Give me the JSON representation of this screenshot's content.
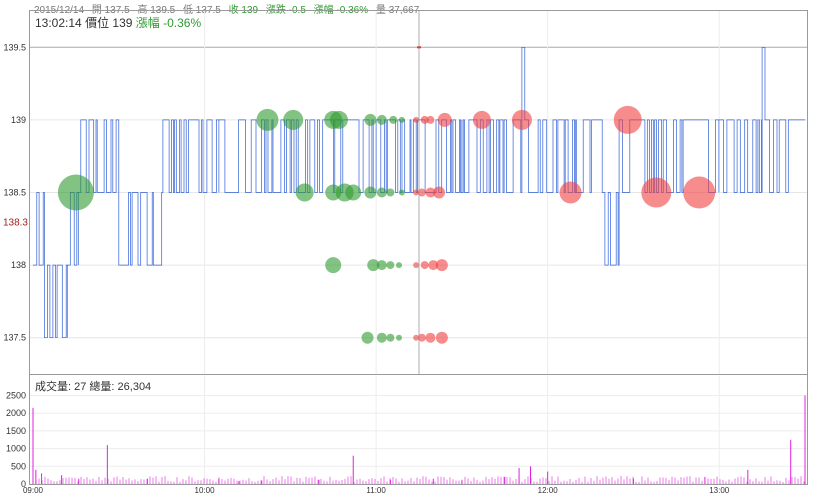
{
  "header": {
    "date": "2015/12/14",
    "open": "開 137.5",
    "high": "高 139.5",
    "low": "低 137.5",
    "close": "收 139",
    "change": "漲跌 -0.5",
    "change_pct": "漲幅 -0.36%",
    "volume": "量 37,667"
  },
  "crosshair": {
    "time": "13:02:14",
    "price_label": "價位 139",
    "change_pct": "漲幅 -0.36%"
  },
  "volume_panel": {
    "trade_volume": "成交量: 27",
    "total_volume": "總量: 26,304"
  },
  "colors": {
    "price_line": "#3060d8",
    "buy_bubble": "#2e9a2e",
    "sell_bubble": "#f04040",
    "volume_bar": "#e020e0",
    "reference_line": "#d04040"
  },
  "chart_data": [
    {
      "type": "line",
      "x_range": [
        "09:00",
        "13:30"
      ],
      "x_ticks": [
        "09:00",
        "10:00",
        "11:00",
        "12:00",
        "13:00"
      ],
      "ylim": [
        137.25,
        139.75
      ],
      "y_ticks": [
        "137.5",
        "138",
        "138.5",
        "139",
        "139.5"
      ],
      "reference_price": "138.3",
      "grid": true,
      "series": [
        {
          "points": [
            [
              "09:00",
              138.0
            ],
            [
              "09:04",
              137.5
            ],
            [
              "09:12",
              138.0
            ],
            [
              "09:16",
              138.5
            ],
            [
              "09:30",
              138.0
            ],
            [
              "09:45",
              138.5
            ],
            [
              "10:00",
              138.5
            ],
            [
              "10:05",
              139.0
            ],
            [
              "10:30",
              138.5
            ],
            [
              "11:00",
              139.0
            ],
            [
              "11:30",
              138.5
            ],
            [
              "11:40",
              139.0
            ],
            [
              "11:51",
              139.5
            ],
            [
              "11:52",
              139.0
            ],
            [
              "12:10",
              138.5
            ],
            [
              "12:20",
              138.0
            ],
            [
              "12:25",
              139.0
            ],
            [
              "12:40",
              138.5
            ],
            [
              "13:00",
              139.0
            ],
            [
              "13:10",
              138.5
            ],
            [
              "13:15",
              139.5
            ],
            [
              "13:16",
              139.0
            ],
            [
              "13:30",
              139.0
            ]
          ]
        }
      ],
      "bubbles": [
        {
          "t": "09:15",
          "price": 138.5,
          "size": 18,
          "side": "buy"
        },
        {
          "t": "10:22",
          "price": 139.0,
          "size": 11,
          "side": "buy"
        },
        {
          "t": "10:31",
          "price": 139.0,
          "size": 10,
          "side": "buy"
        },
        {
          "t": "10:35",
          "price": 138.5,
          "size": 9,
          "side": "buy"
        },
        {
          "t": "10:45",
          "price": 139.0,
          "size": 9,
          "side": "buy"
        },
        {
          "t": "10:47",
          "price": 139.0,
          "size": 9,
          "side": "buy"
        },
        {
          "t": "10:45",
          "price": 138.5,
          "size": 8,
          "side": "buy"
        },
        {
          "t": "10:49",
          "price": 138.5,
          "size": 9,
          "side": "buy"
        },
        {
          "t": "10:52",
          "price": 138.5,
          "size": 8,
          "side": "buy"
        },
        {
          "t": "10:45",
          "price": 138.0,
          "size": 8,
          "side": "buy"
        },
        {
          "t": "10:58",
          "price": 139.0,
          "size": 6,
          "side": "buy"
        },
        {
          "t": "11:02",
          "price": 139.0,
          "size": 5,
          "side": "buy"
        },
        {
          "t": "11:06",
          "price": 139.0,
          "size": 4,
          "side": "buy"
        },
        {
          "t": "11:09",
          "price": 139.0,
          "size": 3,
          "side": "buy"
        },
        {
          "t": "10:58",
          "price": 138.5,
          "size": 6,
          "side": "buy"
        },
        {
          "t": "11:02",
          "price": 138.5,
          "size": 5,
          "side": "buy"
        },
        {
          "t": "11:05",
          "price": 138.5,
          "size": 4,
          "side": "buy"
        },
        {
          "t": "11:09",
          "price": 138.5,
          "size": 3,
          "side": "buy"
        },
        {
          "t": "10:59",
          "price": 138.0,
          "size": 6,
          "side": "buy"
        },
        {
          "t": "11:02",
          "price": 138.0,
          "size": 5,
          "side": "buy"
        },
        {
          "t": "11:05",
          "price": 138.0,
          "size": 4,
          "side": "buy"
        },
        {
          "t": "11:08",
          "price": 138.0,
          "size": 3,
          "side": "buy"
        },
        {
          "t": "10:57",
          "price": 137.5,
          "size": 6,
          "side": "buy"
        },
        {
          "t": "11:02",
          "price": 137.5,
          "size": 5,
          "side": "buy"
        },
        {
          "t": "11:05",
          "price": 137.5,
          "size": 4,
          "side": "buy"
        },
        {
          "t": "11:08",
          "price": 137.5,
          "size": 3,
          "side": "buy"
        },
        {
          "t": "11:14",
          "price": 139.0,
          "size": 3,
          "side": "sell"
        },
        {
          "t": "11:17",
          "price": 139.0,
          "size": 4,
          "side": "sell"
        },
        {
          "t": "11:19",
          "price": 139.0,
          "size": 4,
          "side": "sell"
        },
        {
          "t": "11:24",
          "price": 139.0,
          "size": 7,
          "side": "sell"
        },
        {
          "t": "11:37",
          "price": 139.0,
          "size": 9,
          "side": "sell"
        },
        {
          "t": "11:51",
          "price": 139.0,
          "size": 10,
          "side": "sell"
        },
        {
          "t": "12:28",
          "price": 139.0,
          "size": 14,
          "side": "sell"
        },
        {
          "t": "11:14",
          "price": 138.5,
          "size": 3,
          "side": "sell"
        },
        {
          "t": "11:16",
          "price": 138.5,
          "size": 4,
          "side": "sell"
        },
        {
          "t": "11:19",
          "price": 138.5,
          "size": 5,
          "side": "sell"
        },
        {
          "t": "11:22",
          "price": 138.5,
          "size": 6,
          "side": "sell"
        },
        {
          "t": "12:08",
          "price": 138.5,
          "size": 11,
          "side": "sell"
        },
        {
          "t": "12:38",
          "price": 138.5,
          "size": 15,
          "side": "sell"
        },
        {
          "t": "12:53",
          "price": 138.5,
          "size": 16,
          "side": "sell"
        },
        {
          "t": "11:14",
          "price": 138.0,
          "size": 3,
          "side": "sell"
        },
        {
          "t": "11:17",
          "price": 138.0,
          "size": 4,
          "side": "sell"
        },
        {
          "t": "11:20",
          "price": 138.0,
          "size": 5,
          "side": "sell"
        },
        {
          "t": "11:23",
          "price": 138.0,
          "size": 6,
          "side": "sell"
        },
        {
          "t": "11:14",
          "price": 137.5,
          "size": 3,
          "side": "sell"
        },
        {
          "t": "11:16",
          "price": 137.5,
          "size": 4,
          "side": "sell"
        },
        {
          "t": "11:19",
          "price": 137.5,
          "size": 5,
          "side": "sell"
        },
        {
          "t": "11:23",
          "price": 137.5,
          "size": 6,
          "side": "sell"
        }
      ]
    },
    {
      "type": "bar",
      "x_range": [
        "09:00",
        "13:30"
      ],
      "x_ticks": [
        "09:00",
        "10:00",
        "11:00",
        "12:00",
        "13:00"
      ],
      "ylim": [
        0,
        2600
      ],
      "y_ticks": [
        "0",
        "500",
        "1000",
        "1500",
        "2000",
        "2500"
      ],
      "grid": true,
      "series": [
        {
          "points": [
            [
              "09:00",
              2150
            ],
            [
              "09:01",
              400
            ],
            [
              "09:03",
              300
            ],
            [
              "09:10",
              250
            ],
            [
              "09:16",
              150
            ],
            [
              "09:26",
              1100
            ],
            [
              "09:40",
              150
            ],
            [
              "10:05",
              150
            ],
            [
              "10:12",
              80
            ],
            [
              "10:20",
              100
            ],
            [
              "10:40",
              120
            ],
            [
              "10:52",
              800
            ],
            [
              "11:05",
              120
            ],
            [
              "11:20",
              150
            ],
            [
              "11:30",
              100
            ],
            [
              "11:45",
              200
            ],
            [
              "11:50",
              450
            ],
            [
              "11:54",
              500
            ],
            [
              "12:00",
              350
            ],
            [
              "12:30",
              150
            ],
            [
              "12:55",
              200
            ],
            [
              "13:10",
              400
            ],
            [
              "13:25",
              1250
            ],
            [
              "13:30",
              2500
            ]
          ]
        }
      ]
    }
  ]
}
